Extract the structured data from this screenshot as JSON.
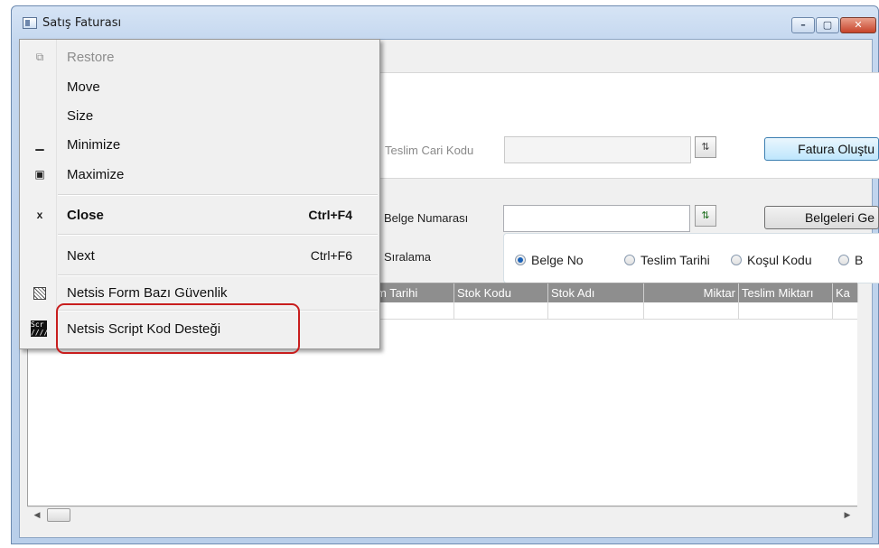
{
  "window": {
    "title": "Satış Faturası",
    "minimize_glyph": "–",
    "maximize_glyph": "▢",
    "close_glyph": "✕"
  },
  "form": {
    "teslim_cari_kodu_label": "Teslim Cari Kodu",
    "teslim_cari_kodu_value": "",
    "belge_numarasi_label": "Belge Numarası",
    "belge_numarasi_value": "",
    "siralama_label": "Sıralama",
    "fatura_olustur_button": "Fatura Oluştu",
    "belgeleri_getir_button": "Belgeleri Ge",
    "radios": [
      {
        "label": "Belge No",
        "checked": true
      },
      {
        "label": "Teslim Tarihi",
        "checked": false
      },
      {
        "label": "Koşul Kodu",
        "checked": false
      },
      {
        "label": "B",
        "checked": false
      }
    ]
  },
  "grid": {
    "columns": [
      "m Tarihi",
      "Stok Kodu",
      "Stok Adı",
      "Miktar",
      "Teslim Miktarı",
      "Ka"
    ]
  },
  "system_menu": {
    "items": [
      {
        "label": "Restore",
        "shortcut": "",
        "icon": "restore-icon",
        "disabled": true
      },
      {
        "label": "Move",
        "shortcut": "",
        "icon": "",
        "disabled": false
      },
      {
        "label": "Size",
        "shortcut": "",
        "icon": "",
        "disabled": false
      },
      {
        "label": "Minimize",
        "shortcut": "",
        "icon": "minimize-icon",
        "disabled": false
      },
      {
        "label": "Maximize",
        "shortcut": "",
        "icon": "maximize-icon",
        "disabled": false
      },
      {
        "label": "Close",
        "shortcut": "Ctrl+F4",
        "icon": "close-icon",
        "disabled": false
      },
      {
        "label": "Next",
        "shortcut": "Ctrl+F6",
        "icon": "",
        "disabled": false
      },
      {
        "label": "Netsis Form Bazı Güvenlik",
        "shortcut": "",
        "icon": "security-icon",
        "disabled": false
      },
      {
        "label": "Netsis Script Kod Desteği",
        "shortcut": "",
        "icon": "script-icon",
        "disabled": false
      }
    ],
    "script_icon_text": "Scr"
  },
  "colors": {
    "highlight_ring": "#c81e1e",
    "grid_header": "#8e8e8e",
    "title_bar": "#c4d7ef"
  }
}
